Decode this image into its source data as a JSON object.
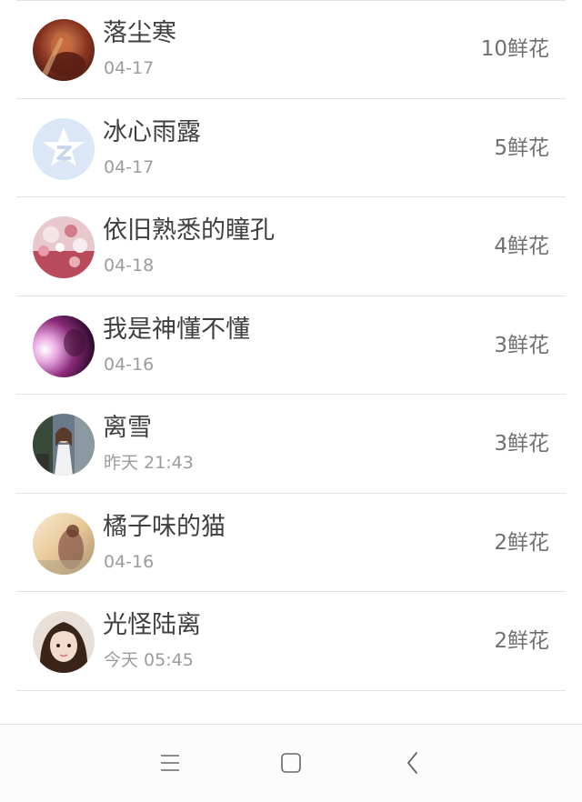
{
  "rows": [
    {
      "name": "落尘寒",
      "date": "04-17",
      "flowers": "10鲜花",
      "avatar_icon": "avatar-photo-warrior"
    },
    {
      "name": "冰心雨露",
      "date": "04-17",
      "flowers": "5鲜花",
      "avatar_icon": "avatar-default-qzone-star"
    },
    {
      "name": "依旧熟悉的瞳孔",
      "date": "04-18",
      "flowers": "4鲜花",
      "avatar_icon": "avatar-photo-flowers"
    },
    {
      "name": "我是神懂不懂",
      "date": "04-16",
      "flowers": "3鲜花",
      "avatar_icon": "avatar-photo-purple"
    },
    {
      "name": "离雪",
      "date": "昨天 21:43",
      "flowers": "3鲜花",
      "avatar_icon": "avatar-photo-girl-white-dress"
    },
    {
      "name": "橘子味的猫",
      "date": "04-16",
      "flowers": "2鲜花",
      "avatar_icon": "avatar-photo-sunset"
    },
    {
      "name": "光怪陆离",
      "date": "今天 05:45",
      "flowers": "2鲜花",
      "avatar_icon": "avatar-photo-girl-portrait"
    }
  ],
  "navbar": {
    "menu_icon": "menu-icon",
    "home_icon": "home-square-icon",
    "back_icon": "back-chevron-icon"
  },
  "colors": {
    "name": "#3f3f3f",
    "date": "#9c9c9c",
    "flowers": "#707070",
    "divider": "#e2e2e2"
  }
}
